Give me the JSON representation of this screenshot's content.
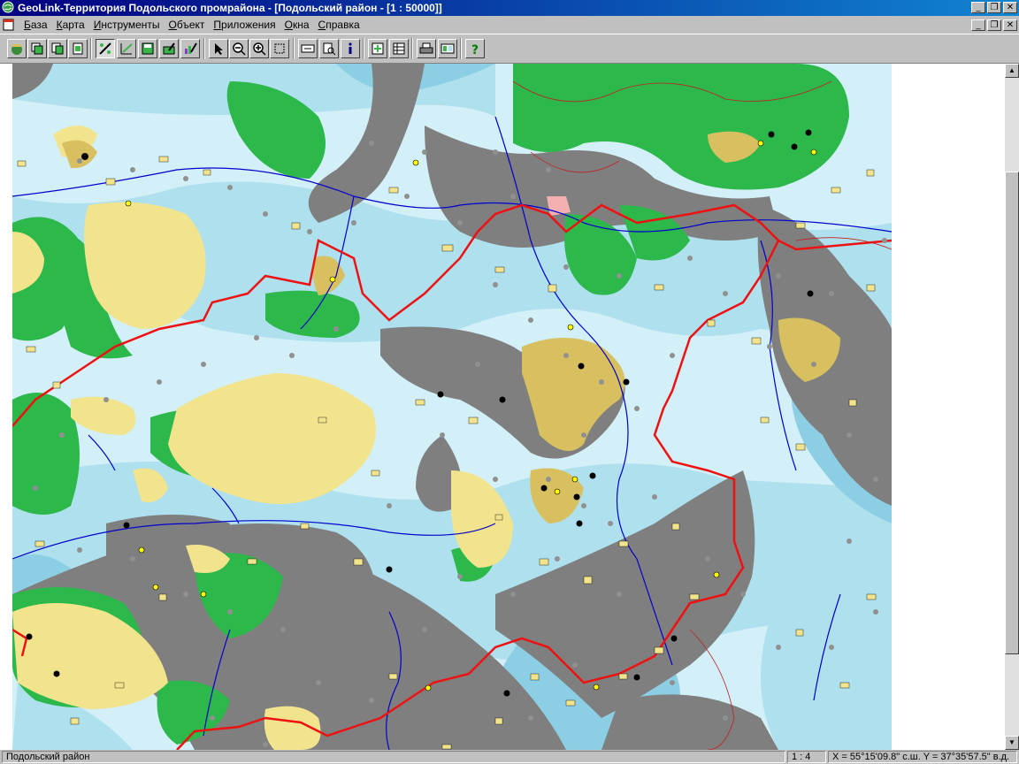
{
  "window": {
    "title": "GeoLink-Территория Подольского промрайона - [Подольский район - [1 : 50000]]",
    "controls": [
      "_",
      "❐",
      "✕"
    ]
  },
  "menu": {
    "items": [
      {
        "label": "База",
        "underline": "Б",
        "rest": "аза"
      },
      {
        "label": "Карта",
        "underline": "К",
        "rest": "арта"
      },
      {
        "label": "Инструменты",
        "underline": "И",
        "rest": "нструменты"
      },
      {
        "label": "Объект",
        "underline": "О",
        "rest": "бъект"
      },
      {
        "label": "Приложения",
        "underline": "П",
        "rest": "риложения"
      },
      {
        "label": "Окна",
        "underline": "О",
        "rest": "кна"
      },
      {
        "label": "Справка",
        "underline": "С",
        "rest": "правка"
      }
    ]
  },
  "toolbar": {
    "buttons": [
      "open-map",
      "layers",
      "copy",
      "page",
      "legend",
      "edit-layer",
      "save-layer",
      "layer-props",
      "chart-layer",
      "select-arrow",
      "zoom-out",
      "zoom-in",
      "zoom-box",
      "label",
      "find",
      "info",
      "add-object",
      "table",
      "print",
      "export",
      "help"
    ]
  },
  "map": {
    "colors": {
      "water_light": "#d3eff8",
      "water_mid": "#aee0ee",
      "water_deep": "#8ccfe4",
      "urban_gray": "#7f7f7f",
      "forest_green": "#2db84b",
      "field_yellow": "#f2e48c",
      "town_tan": "#d8c060",
      "boundary_red": "#ee1111",
      "river_blue": "#0000cc"
    }
  },
  "status": {
    "district": "Подольский район",
    "scale": "1 : 4",
    "coords": "X = 55°15'09.8\" с.ш.  Y = 37°35'57.5\" в.д."
  }
}
